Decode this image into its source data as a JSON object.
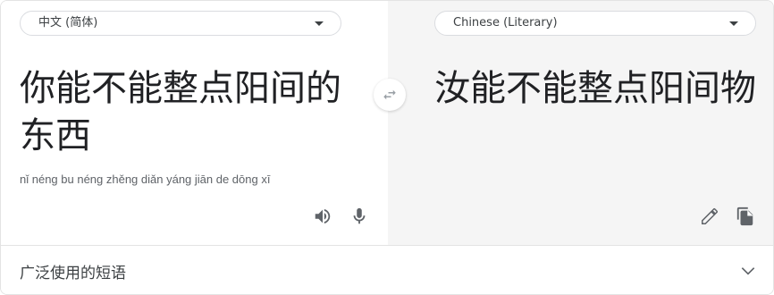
{
  "source": {
    "language": "中文 (简体)",
    "text": "你能不能整点阳间的东西",
    "romanization": "nǐ néng bu néng zhěng diǎn yáng jiān de dōng xī"
  },
  "target": {
    "language": "Chinese (Literary)",
    "text": "汝能不能整点阳间物"
  },
  "footer": {
    "label": "广泛使用的短语"
  },
  "icons": {
    "swap": "swap-icon",
    "speaker": "speaker-icon",
    "microphone": "microphone-icon",
    "edit": "pencil-icon",
    "copy": "copy-icon",
    "expand": "chevron-down-icon"
  },
  "colors": {
    "text": "#202124",
    "muted": "#5f6368",
    "icon": "#5f6368",
    "target_background": "#f5f5f5",
    "border": "#dadce0"
  }
}
